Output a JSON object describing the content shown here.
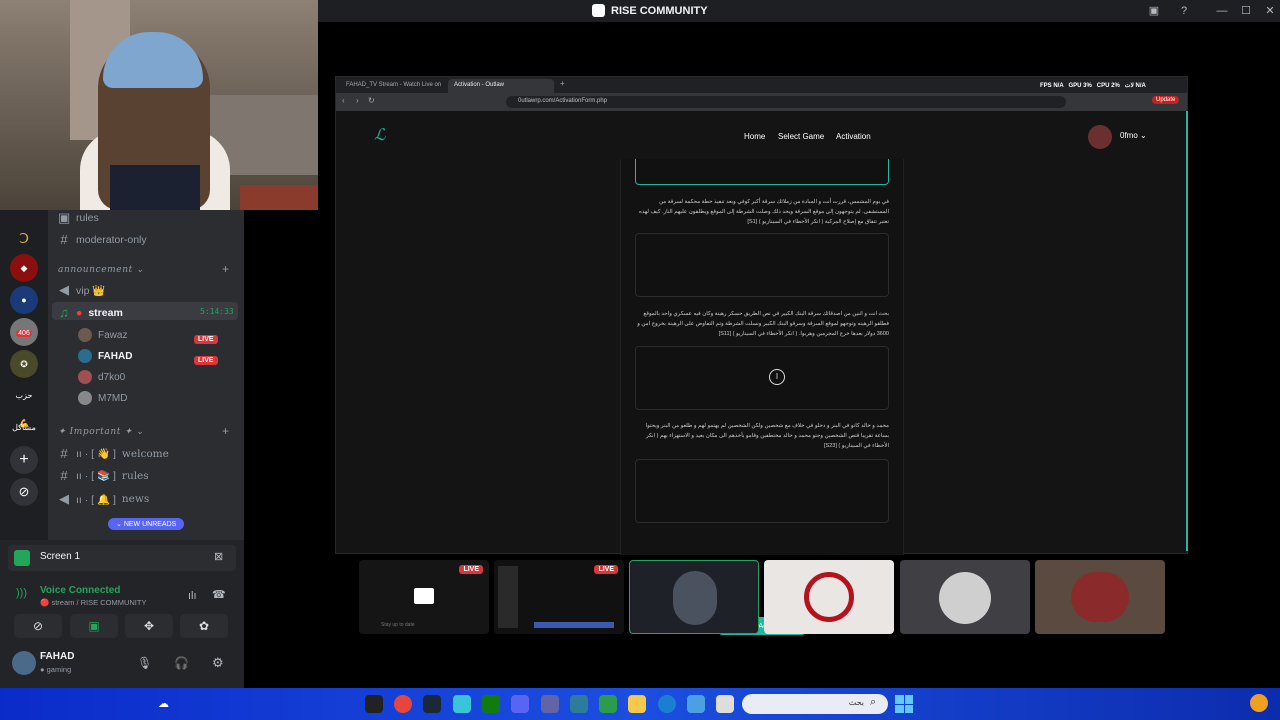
{
  "window": {
    "title": "RISE COMMUNITY"
  },
  "sidebar": {
    "servers": [
      {
        "label": "406"
      },
      {
        "label": "حزب 💪"
      },
      {
        "label": "مشاكل"
      }
    ],
    "channels": [
      {
        "name": "rules"
      },
      {
        "name": "moderator-only"
      }
    ],
    "category_announcement": "announcement",
    "vip": "vip 👑",
    "stream": {
      "name": "stream",
      "time": "5:14:33"
    },
    "users": [
      {
        "name": "Fawaz",
        "live": "LIVE"
      },
      {
        "name": "FAHAD",
        "live": "LIVE"
      },
      {
        "name": "d7ko0"
      },
      {
        "name": "M7MD"
      }
    ],
    "category_important": "Important",
    "important_channels": [
      {
        "name": "welcome"
      },
      {
        "name": "rules"
      },
      {
        "name": "news"
      }
    ],
    "new_unreads": "NEW UNREADS"
  },
  "panel": {
    "screen": "Screen 1",
    "voice_connected": "Voice Connected",
    "voice_channel": "stream / RISE COMMUNITY",
    "username": "FAHAD",
    "status": "gaming"
  },
  "browser": {
    "tabs": [
      {
        "label": "FAHAD_TV Stream - Watch Live on"
      },
      {
        "label": "Activation - Outlaw"
      }
    ],
    "url": "0utlawrp.com/ActivationForm.php",
    "stats": "FPS N/A   GPU 3%   CPU 2%   لات N/A",
    "update": "Update",
    "site_nav": [
      {
        "label": "Home"
      },
      {
        "label": "Select Game"
      },
      {
        "label": "Activation"
      }
    ],
    "username": "0fmo",
    "questions": [
      {
        "text": "في يوم المشمس، قررت أنت و المبادة من زملائك سرقة أكبر كوفي وبعد تنفيذ خطة محكمة لسرقة من المستشفى. لم يتوجهون إلى موقع السرقة ويحد ذلك وصلت الشرطة إلى الموقع ويطلقون عليهم النار. كيف لهذه تعتبر تتفاق مع إصلاح المركبة ( انكر الأخطاء في السيناريو ) [S1]"
      },
      {
        "text": "بحث انت و اثنين من اصدقائك سرقة البنك الكبير في نص الطريق حسكر رهينة وكان فيه عسكري واحد بالموقع فطلقو الرهينه وتوجهو لموقع السرقة وسرقو البنك الكبير ونسلت الشرطة وتم التفاوض على الرهينة بخروج امن و 3600 دولار بعدها خرج المجرمين وهربوا. ( انكر الأخطاء في السيناريو ) [S11]"
      },
      {
        "text": "محمد و خالد كانو في البنر و دخلو في خلاف مع شخصين ولكن الشخصين لم يهتمو لهم و طلعو من البنر ويحتوا بساعة تقريبا قتص الشخصين وجتو محمد و خالد مختطفين وقامو بأخذهم الى مكان بعيد و الاستهزاء بهم ( انكر الأخطاء في السيناريو ) [S23]"
      }
    ],
    "submit": "Submit Activation"
  },
  "thumbs": [
    {
      "live": "LIVE",
      "caption": "Stay up to date"
    },
    {
      "live": "LIVE"
    },
    {},
    {},
    {},
    {}
  ],
  "taskbar": {
    "search_placeholder": "بحث"
  }
}
